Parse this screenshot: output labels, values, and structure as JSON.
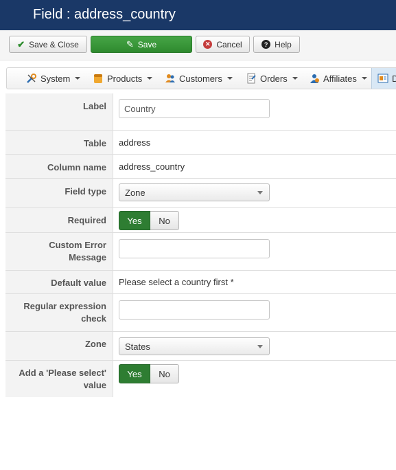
{
  "header": {
    "title": "Field : address_country"
  },
  "toolbar": {
    "save_close": "Save & Close",
    "save": "Save",
    "cancel": "Cancel",
    "help": "Help"
  },
  "menu": {
    "items": [
      {
        "label": "System",
        "icon": "tools-icon"
      },
      {
        "label": "Products",
        "icon": "products-icon"
      },
      {
        "label": "Customers",
        "icon": "customers-icon"
      },
      {
        "label": "Orders",
        "icon": "orders-icon"
      },
      {
        "label": "Affiliates",
        "icon": "affiliates-icon"
      },
      {
        "label": "D",
        "icon": "display-icon"
      }
    ]
  },
  "form": {
    "label": {
      "label": "Label",
      "value": "Country"
    },
    "table": {
      "label": "Table",
      "value": "address"
    },
    "column": {
      "label": "Column name",
      "value": "address_country"
    },
    "field_type": {
      "label": "Field type",
      "value": "Zone"
    },
    "required": {
      "label": "Required",
      "yes": "Yes",
      "no": "No",
      "selected": "Yes"
    },
    "custom_error": {
      "label_line1": "Custom Error",
      "label_line2": "Message",
      "value": ""
    },
    "default_value": {
      "label": "Default value",
      "value": "Please select a country first *"
    },
    "regex": {
      "label_line1": "Regular expression",
      "label_line2": "check",
      "value": ""
    },
    "zone": {
      "label": "Zone",
      "value": "States"
    },
    "please_select": {
      "label_line1": "Add a 'Please select'",
      "label_line2": "value",
      "yes": "Yes",
      "no": "No",
      "selected": "Yes"
    }
  },
  "colors": {
    "header_bg": "#1a3867",
    "save_green": "#3b9a3b",
    "toggle_on": "#2e7d32"
  }
}
